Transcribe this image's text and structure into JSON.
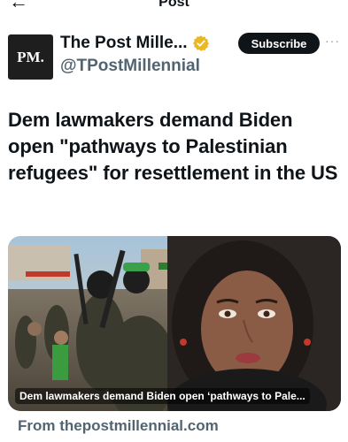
{
  "header": {
    "back_icon": "arrow-left-icon",
    "title": "Post"
  },
  "author": {
    "avatar_text": "PM.",
    "display_name": "The Post Mille...",
    "verified_badge": "gold-verified-badge-icon",
    "handle": "@TPostMillennial",
    "subscribe_label": "Subscribe",
    "more_icon": "more-horizontal-icon",
    "more_glyph": "···"
  },
  "post": {
    "text": "Dem lawmakers demand Biden open \"pathways to Palestinian refugees\" for resettlement in the US"
  },
  "link_card": {
    "caption": "Dem lawmakers demand Biden open ‘pathways to Pale...",
    "source": "From thepostmillennial.com"
  },
  "colors": {
    "text": "#0f1419",
    "secondary": "#536471",
    "badge_gold": "#e8b827",
    "button_bg": "#0f1419"
  }
}
